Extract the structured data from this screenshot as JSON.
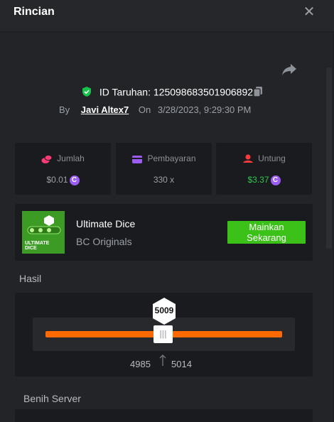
{
  "header": {
    "title": "Rincian",
    "close_icon": "close-icon"
  },
  "bet": {
    "id_label": "ID Taruhan:",
    "id_value": "125098683501906892",
    "by_label": "By",
    "username": "Javi Altex7",
    "on_label": "On",
    "datetime": "3/28/2023, 9:29:30 PM"
  },
  "stats": {
    "amount": {
      "label": "Jumlah",
      "value": "$0.01",
      "icon": "coins-icon"
    },
    "payout": {
      "label": "Pembayaran",
      "value": "330 x",
      "icon": "wallet-icon"
    },
    "profit": {
      "label": "Untung",
      "value": "$3.37",
      "icon": "profit-icon"
    },
    "coin_symbol": "C"
  },
  "game": {
    "name": "Ultimate Dice",
    "provider": "BC Originals",
    "thumb_text": "ULTIMATE DICE",
    "play_label": "Mainkan Sekarang"
  },
  "result": {
    "section_label": "Hasil",
    "value": "5009",
    "range_low": "4985",
    "range_high": "5014",
    "handle_glyph": "|||",
    "roll_fraction": 0.5009
  },
  "seed": {
    "section_label": "Benih Server"
  },
  "colors": {
    "accent_green": "#3bc117",
    "profit_green": "#2ec653",
    "slider_orange": "#ff6a00",
    "coin_purple": "#9b5cf2",
    "shield_green": "#19c24a"
  }
}
